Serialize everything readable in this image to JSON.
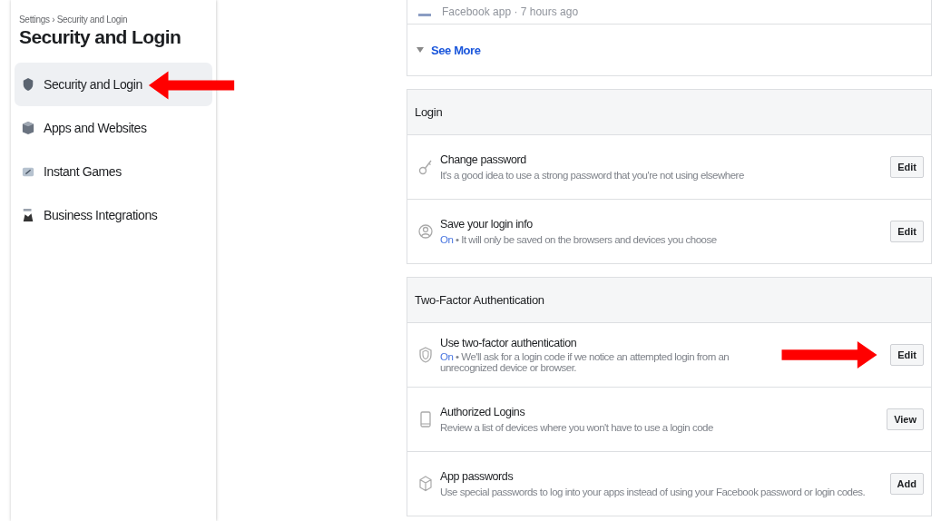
{
  "sidebar": {
    "breadcrumb": "Settings › Security and Login",
    "title": "Security and Login",
    "items": [
      {
        "label": "Security and Login",
        "kind": "shield",
        "selected": true
      },
      {
        "label": "Apps and Websites",
        "kind": "cube",
        "selected": false
      },
      {
        "label": "Instant Games",
        "kind": "game",
        "selected": false
      },
      {
        "label": "Business Integrations",
        "kind": "business",
        "selected": false
      }
    ]
  },
  "sessions": {
    "partial_entry": "Facebook app · 7 hours ago",
    "see_more": "See More"
  },
  "sections": [
    {
      "title": "Login",
      "rows": [
        {
          "kind": "key",
          "title": "Change password",
          "description": "It's a good idea to use a strong password that you're not using elsewhere",
          "button": "Edit"
        },
        {
          "kind": "person",
          "title": "Save your login info",
          "status": "On",
          "description": " • It will only be saved on the browsers and devices you choose",
          "button": "Edit"
        }
      ]
    },
    {
      "title": "Two-Factor Authentication",
      "rows": [
        {
          "kind": "shield",
          "title": "Use two-factor authentication",
          "status": "On",
          "description": " • We'll ask for a login code if we notice an attempted login from an unrecognized device or browser.",
          "button": "Edit",
          "pointer": true
        },
        {
          "kind": "phone",
          "title": "Authorized Logins",
          "description": "Review a list of devices where you won't have to use a login code",
          "button": "View"
        },
        {
          "kind": "cube",
          "title": "App passwords",
          "description": "Use special passwords to log into your apps instead of using your Facebook password or login codes.",
          "button": "Add"
        }
      ]
    }
  ]
}
